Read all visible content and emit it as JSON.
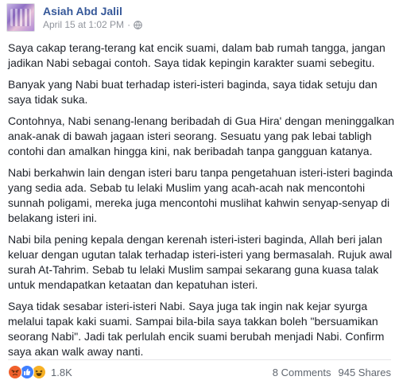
{
  "post": {
    "author": "Asiah Abd Jalil",
    "date": "April 15 at 1:02 PM",
    "separator": "·",
    "privacy_icon": "globe-icon",
    "paragraphs": [
      "Saya cakap terang-terang kat encik suami, dalam bab rumah tangga, jangan jadikan Nabi sebagai contoh. Saya tidak kepingin karakter suami sebegitu.",
      "Banyak yang Nabi buat terhadap isteri-isteri baginda, saya tidak setuju dan saya tidak suka.",
      "Contohnya, Nabi senang-lenang beribadah di Gua Hira' dengan meninggalkan anak-anak di bawah jagaan isteri seorang. Sesuatu yang pak lebai tabligh contohi dan amalkan hingga kini, nak beribadah tanpa gangguan katanya.",
      "Nabi berkahwin lain dengan isteri baru tanpa pengetahuan isteri-isteri baginda yang sedia ada. Sebab tu lelaki Muslim yang acah-acah nak mencontohi sunnah poligami, mereka juga mencontohi muslihat kahwin senyap-senyap di belakang isteri ini.",
      "Nabi bila pening kepala dengan kerenah isteri-isteri baginda, Allah beri jalan keluar dengan ugutan talak terhadap isteri-isteri yang bermasalah. Rujuk awal surah At-Tahrim. Sebab tu lelaki Muslim sampai sekarang guna kuasa talak untuk mendapatkan ketaatan dan kepatuhan isteri.",
      "Saya tidak sesabar isteri-isteri Nabi. Saya juga tak ingin nak kejar syurga melalui tapak kaki suami. Sampai bila-bila saya takkan boleh \"bersuamikan seorang Nabi\". Jadi tak perlulah encik suami berubah menjadi Nabi. Confirm saya akan walk away nanti."
    ]
  },
  "footer": {
    "reactions": [
      "angry-reaction-icon",
      "like-reaction-icon",
      "haha-reaction-icon"
    ],
    "reaction_count": "1.8K",
    "comments": "8 Comments",
    "shares": "945 Shares"
  },
  "colors": {
    "link": "#365899",
    "text": "#1d2129",
    "muted": "#90949c",
    "like_blue": "#4080ff",
    "angry_orange": "#f0602c",
    "haha_yellow": "#f7b125"
  }
}
